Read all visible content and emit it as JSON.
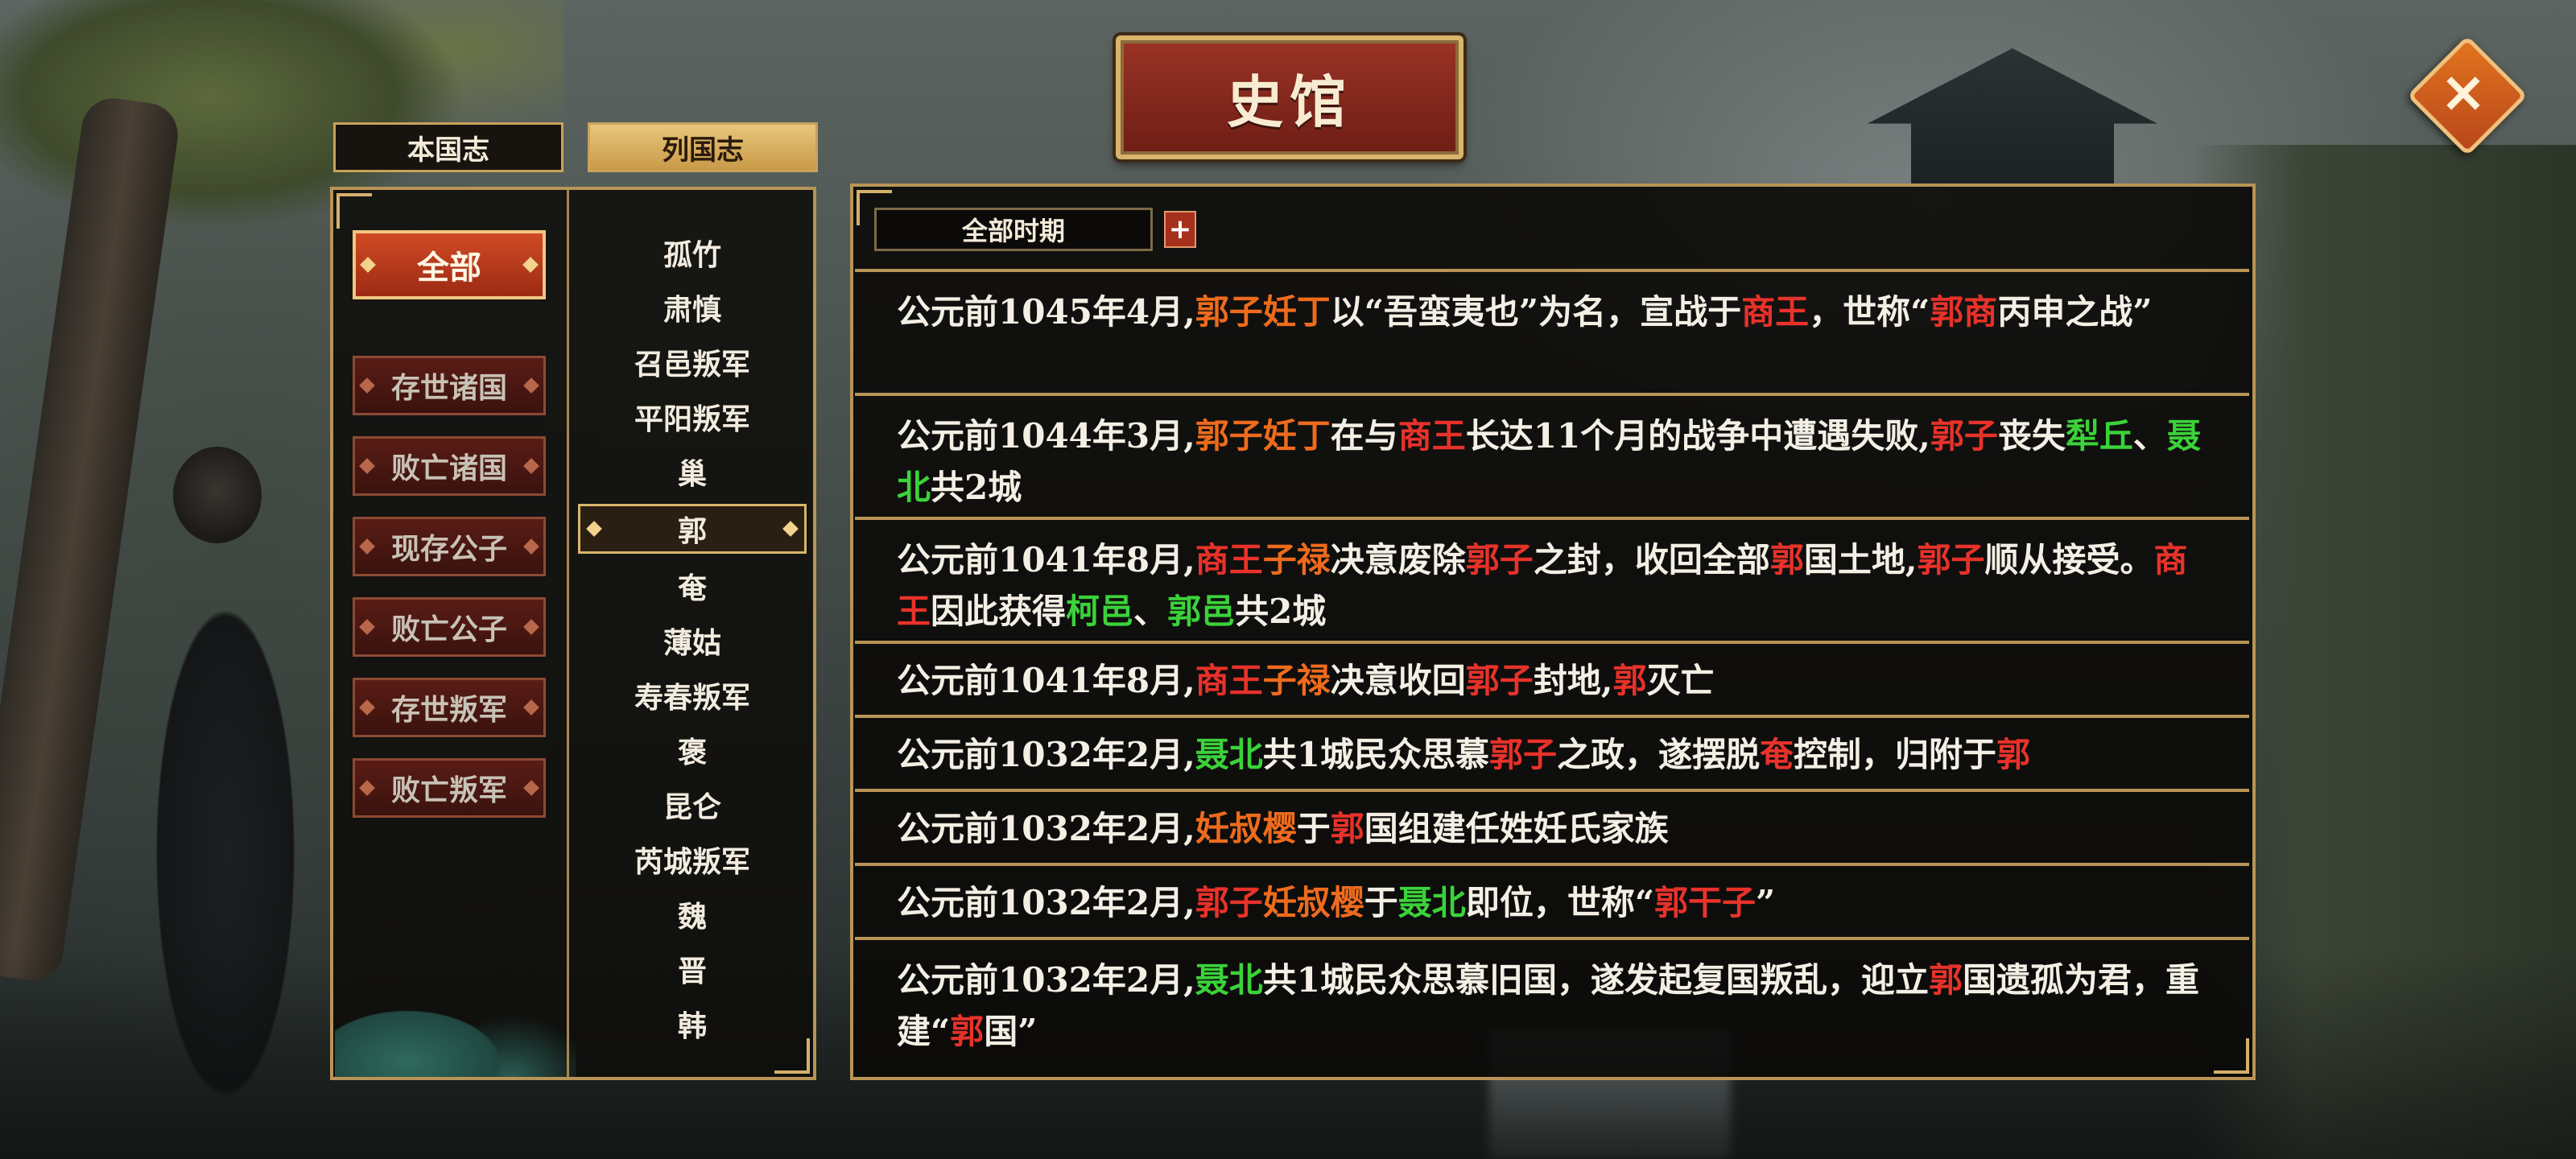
{
  "title": "史馆",
  "tabs": [
    {
      "label": "本国志",
      "active": false
    },
    {
      "label": "列国志",
      "active": true
    }
  ],
  "categories": [
    "全部",
    "存世诸国",
    "败亡诸国",
    "现存公子",
    "败亡公子",
    "存世叛军",
    "败亡叛军"
  ],
  "selected_category": "全部",
  "nations": [
    "孤竹",
    "肃慎",
    "召邑叛军",
    "平阳叛军",
    "巢",
    "郭",
    "奄",
    "薄姑",
    "寿春叛军",
    "褒",
    "昆仑",
    "芮城叛军",
    "魏",
    "晋",
    "韩"
  ],
  "selected_nation": "郭",
  "period": {
    "label": "全部时期",
    "plus": "+"
  },
  "colors": {
    "red": "#e8322a",
    "orange": "#ee6b1d",
    "green": "#3bd23a",
    "gold": "#b89456"
  },
  "records": [
    {
      "lines": 2,
      "segments": [
        {
          "t": "公元前1045年4月,"
        },
        {
          "t": "郭子妊丁",
          "c": "o"
        },
        {
          "t": "以“吾蛮夷也”为名，宣战于"
        },
        {
          "t": "商王",
          "c": "r"
        },
        {
          "t": "，世称“"
        },
        {
          "t": "郭",
          "c": "r"
        },
        {
          "t": "商",
          "c": "r"
        },
        {
          "t": "丙申之战”"
        }
      ]
    },
    {
      "lines": 2,
      "segments": [
        {
          "t": "公元前1044年3月,"
        },
        {
          "t": "郭子妊丁",
          "c": "o"
        },
        {
          "t": "在与"
        },
        {
          "t": "商王",
          "c": "r"
        },
        {
          "t": "长达11个月的战争中遭遇失败,"
        },
        {
          "t": "郭子",
          "c": "r"
        },
        {
          "t": "丧失"
        },
        {
          "t": "犁丘",
          "c": "g"
        },
        {
          "t": "、"
        },
        {
          "t": "聂北",
          "c": "g"
        },
        {
          "t": "共2城"
        }
      ]
    },
    {
      "lines": 2,
      "segments": [
        {
          "t": "公元前1041年8月,"
        },
        {
          "t": "商王",
          "c": "r"
        },
        {
          "t": "子禄",
          "c": "o"
        },
        {
          "t": "决意废除"
        },
        {
          "t": "郭子",
          "c": "r"
        },
        {
          "t": "之封，收回全部"
        },
        {
          "t": "郭",
          "c": "r"
        },
        {
          "t": "国土地,"
        },
        {
          "t": "郭子",
          "c": "r"
        },
        {
          "t": "顺从接受。"
        },
        {
          "t": "商王",
          "c": "r"
        },
        {
          "t": "因此获得"
        },
        {
          "t": "柯邑",
          "c": "g"
        },
        {
          "t": "、"
        },
        {
          "t": "郭邑",
          "c": "g"
        },
        {
          "t": "共2城"
        }
      ]
    },
    {
      "lines": 1,
      "segments": [
        {
          "t": "公元前1041年8月,"
        },
        {
          "t": "商王",
          "c": "r"
        },
        {
          "t": "子禄",
          "c": "o"
        },
        {
          "t": "决意收回"
        },
        {
          "t": "郭子",
          "c": "r"
        },
        {
          "t": "封地,"
        },
        {
          "t": "郭",
          "c": "r"
        },
        {
          "t": "灭亡"
        }
      ]
    },
    {
      "lines": 1,
      "segments": [
        {
          "t": "公元前1032年2月,"
        },
        {
          "t": "聂北",
          "c": "g"
        },
        {
          "t": "共1城民众思慕"
        },
        {
          "t": "郭子",
          "c": "r"
        },
        {
          "t": "之政，遂摆脱"
        },
        {
          "t": "奄",
          "c": "r"
        },
        {
          "t": "控制，归附于"
        },
        {
          "t": "郭",
          "c": "r"
        }
      ]
    },
    {
      "lines": 1,
      "segments": [
        {
          "t": "公元前1032年2月,"
        },
        {
          "t": "妊叔樱",
          "c": "o"
        },
        {
          "t": "于"
        },
        {
          "t": "郭",
          "c": "r"
        },
        {
          "t": "国组建任姓妊氏家族"
        }
      ]
    },
    {
      "lines": 1,
      "segments": [
        {
          "t": "公元前1032年2月,"
        },
        {
          "t": "郭子",
          "c": "r"
        },
        {
          "t": "妊叔樱",
          "c": "o"
        },
        {
          "t": "于"
        },
        {
          "t": "聂北",
          "c": "g"
        },
        {
          "t": "即位，世称“"
        },
        {
          "t": "郭干子",
          "c": "r"
        },
        {
          "t": "”"
        }
      ]
    },
    {
      "lines": 2,
      "segments": [
        {
          "t": "公元前1032年2月,"
        },
        {
          "t": "聂北",
          "c": "g"
        },
        {
          "t": "共1城民众思慕旧国，遂发起复国叛乱，迎立"
        },
        {
          "t": "郭",
          "c": "r"
        },
        {
          "t": "国遗孤为君，重建“"
        },
        {
          "t": "郭",
          "c": "r"
        },
        {
          "t": "国”"
        }
      ]
    }
  ]
}
